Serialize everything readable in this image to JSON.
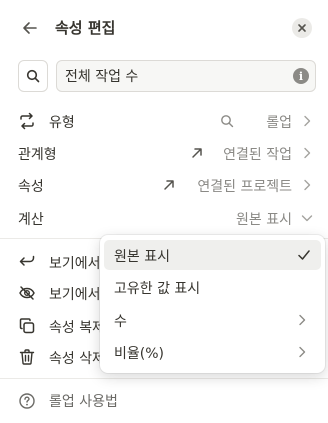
{
  "header": {
    "title": "속성 편집"
  },
  "name_field": {
    "value": "전체 작업 수"
  },
  "settings": [
    {
      "label": "유형",
      "value": "롤업"
    },
    {
      "label": "관계형",
      "value": "연결된 작업"
    },
    {
      "label": "속성",
      "value": "연결된 프로젝트"
    },
    {
      "label": "계산",
      "value": "원본 표시"
    }
  ],
  "actions": [
    {
      "label": "보기에서",
      "icon": "return-arrow-icon"
    },
    {
      "label": "보기에서",
      "icon": "eye-off-icon"
    },
    {
      "label": "속성 복제",
      "icon": "duplicate-icon"
    },
    {
      "label": "속성 삭제",
      "icon": "trash-icon"
    }
  ],
  "dropdown": {
    "items": [
      {
        "label": "원본 표시",
        "selected": true,
        "has_submenu": false
      },
      {
        "label": "고유한 값 표시",
        "selected": false,
        "has_submenu": false
      },
      {
        "label": "수",
        "selected": false,
        "has_submenu": true
      },
      {
        "label": "비율(%)",
        "selected": false,
        "has_submenu": true
      }
    ]
  },
  "footer": {
    "help_label": "롤업 사용법"
  },
  "colors": {
    "text": "#37352f",
    "muted": "#8b8a86",
    "divider": "#ebeae7",
    "hover": "#efefed"
  }
}
